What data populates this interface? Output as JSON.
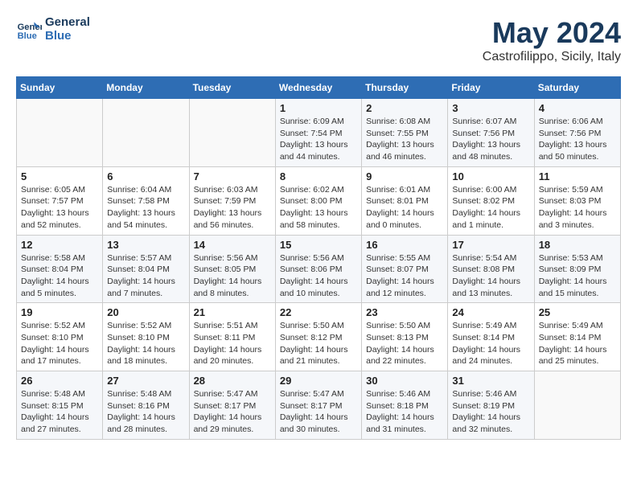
{
  "header": {
    "logo_line1": "General",
    "logo_line2": "Blue",
    "month": "May 2024",
    "location": "Castrofilippo, Sicily, Italy"
  },
  "weekdays": [
    "Sunday",
    "Monday",
    "Tuesday",
    "Wednesday",
    "Thursday",
    "Friday",
    "Saturday"
  ],
  "weeks": [
    [
      {
        "day": "",
        "info": ""
      },
      {
        "day": "",
        "info": ""
      },
      {
        "day": "",
        "info": ""
      },
      {
        "day": "1",
        "info": "Sunrise: 6:09 AM\nSunset: 7:54 PM\nDaylight: 13 hours\nand 44 minutes."
      },
      {
        "day": "2",
        "info": "Sunrise: 6:08 AM\nSunset: 7:55 PM\nDaylight: 13 hours\nand 46 minutes."
      },
      {
        "day": "3",
        "info": "Sunrise: 6:07 AM\nSunset: 7:56 PM\nDaylight: 13 hours\nand 48 minutes."
      },
      {
        "day": "4",
        "info": "Sunrise: 6:06 AM\nSunset: 7:56 PM\nDaylight: 13 hours\nand 50 minutes."
      }
    ],
    [
      {
        "day": "5",
        "info": "Sunrise: 6:05 AM\nSunset: 7:57 PM\nDaylight: 13 hours\nand 52 minutes."
      },
      {
        "day": "6",
        "info": "Sunrise: 6:04 AM\nSunset: 7:58 PM\nDaylight: 13 hours\nand 54 minutes."
      },
      {
        "day": "7",
        "info": "Sunrise: 6:03 AM\nSunset: 7:59 PM\nDaylight: 13 hours\nand 56 minutes."
      },
      {
        "day": "8",
        "info": "Sunrise: 6:02 AM\nSunset: 8:00 PM\nDaylight: 13 hours\nand 58 minutes."
      },
      {
        "day": "9",
        "info": "Sunrise: 6:01 AM\nSunset: 8:01 PM\nDaylight: 14 hours\nand 0 minutes."
      },
      {
        "day": "10",
        "info": "Sunrise: 6:00 AM\nSunset: 8:02 PM\nDaylight: 14 hours\nand 1 minute."
      },
      {
        "day": "11",
        "info": "Sunrise: 5:59 AM\nSunset: 8:03 PM\nDaylight: 14 hours\nand 3 minutes."
      }
    ],
    [
      {
        "day": "12",
        "info": "Sunrise: 5:58 AM\nSunset: 8:04 PM\nDaylight: 14 hours\nand 5 minutes."
      },
      {
        "day": "13",
        "info": "Sunrise: 5:57 AM\nSunset: 8:04 PM\nDaylight: 14 hours\nand 7 minutes."
      },
      {
        "day": "14",
        "info": "Sunrise: 5:56 AM\nSunset: 8:05 PM\nDaylight: 14 hours\nand 8 minutes."
      },
      {
        "day": "15",
        "info": "Sunrise: 5:56 AM\nSunset: 8:06 PM\nDaylight: 14 hours\nand 10 minutes."
      },
      {
        "day": "16",
        "info": "Sunrise: 5:55 AM\nSunset: 8:07 PM\nDaylight: 14 hours\nand 12 minutes."
      },
      {
        "day": "17",
        "info": "Sunrise: 5:54 AM\nSunset: 8:08 PM\nDaylight: 14 hours\nand 13 minutes."
      },
      {
        "day": "18",
        "info": "Sunrise: 5:53 AM\nSunset: 8:09 PM\nDaylight: 14 hours\nand 15 minutes."
      }
    ],
    [
      {
        "day": "19",
        "info": "Sunrise: 5:52 AM\nSunset: 8:10 PM\nDaylight: 14 hours\nand 17 minutes."
      },
      {
        "day": "20",
        "info": "Sunrise: 5:52 AM\nSunset: 8:10 PM\nDaylight: 14 hours\nand 18 minutes."
      },
      {
        "day": "21",
        "info": "Sunrise: 5:51 AM\nSunset: 8:11 PM\nDaylight: 14 hours\nand 20 minutes."
      },
      {
        "day": "22",
        "info": "Sunrise: 5:50 AM\nSunset: 8:12 PM\nDaylight: 14 hours\nand 21 minutes."
      },
      {
        "day": "23",
        "info": "Sunrise: 5:50 AM\nSunset: 8:13 PM\nDaylight: 14 hours\nand 22 minutes."
      },
      {
        "day": "24",
        "info": "Sunrise: 5:49 AM\nSunset: 8:14 PM\nDaylight: 14 hours\nand 24 minutes."
      },
      {
        "day": "25",
        "info": "Sunrise: 5:49 AM\nSunset: 8:14 PM\nDaylight: 14 hours\nand 25 minutes."
      }
    ],
    [
      {
        "day": "26",
        "info": "Sunrise: 5:48 AM\nSunset: 8:15 PM\nDaylight: 14 hours\nand 27 minutes."
      },
      {
        "day": "27",
        "info": "Sunrise: 5:48 AM\nSunset: 8:16 PM\nDaylight: 14 hours\nand 28 minutes."
      },
      {
        "day": "28",
        "info": "Sunrise: 5:47 AM\nSunset: 8:17 PM\nDaylight: 14 hours\nand 29 minutes."
      },
      {
        "day": "29",
        "info": "Sunrise: 5:47 AM\nSunset: 8:17 PM\nDaylight: 14 hours\nand 30 minutes."
      },
      {
        "day": "30",
        "info": "Sunrise: 5:46 AM\nSunset: 8:18 PM\nDaylight: 14 hours\nand 31 minutes."
      },
      {
        "day": "31",
        "info": "Sunrise: 5:46 AM\nSunset: 8:19 PM\nDaylight: 14 hours\nand 32 minutes."
      },
      {
        "day": "",
        "info": ""
      }
    ]
  ]
}
